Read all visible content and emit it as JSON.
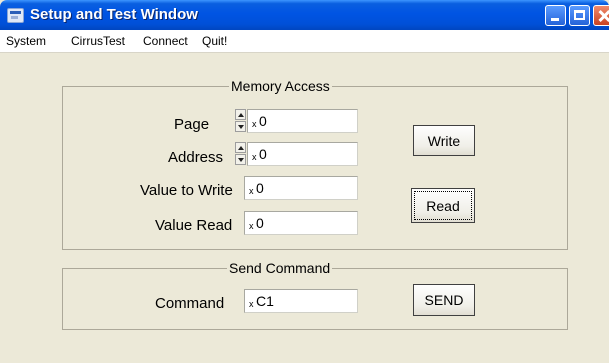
{
  "window": {
    "title": "Setup and Test Window"
  },
  "menu": {
    "items": [
      "System",
      "CirrusTest",
      "Connect",
      "Quit!"
    ]
  },
  "memory_access": {
    "legend": "Memory Access",
    "page": {
      "label": "Page",
      "prefix": "x",
      "value": "0"
    },
    "address": {
      "label": "Address",
      "prefix": "x",
      "value": "0"
    },
    "value_to_write": {
      "label": "Value to Write",
      "prefix": "x",
      "value": "0"
    },
    "value_read": {
      "label": "Value Read",
      "prefix": "x",
      "value": "0"
    },
    "write_button": "Write",
    "read_button": "Read"
  },
  "send_command": {
    "legend": "Send Command",
    "command": {
      "label": "Command",
      "prefix": "x",
      "value": "C1"
    },
    "send_button": "SEND"
  }
}
